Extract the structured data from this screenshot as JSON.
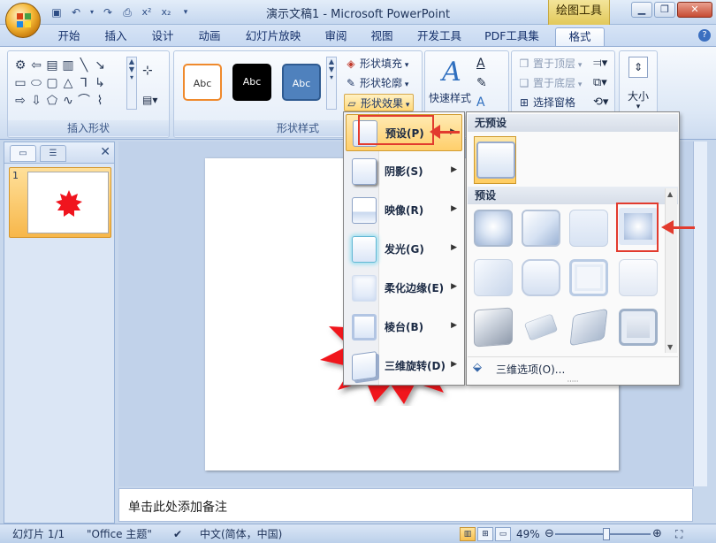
{
  "window": {
    "title": "演示文稿1 - Microsoft PowerPoint",
    "context_tool": "绘图工具"
  },
  "tabs": [
    {
      "label": "开始"
    },
    {
      "label": "插入"
    },
    {
      "label": "设计"
    },
    {
      "label": "动画"
    },
    {
      "label": "幻灯片放映"
    },
    {
      "label": "审阅"
    },
    {
      "label": "视图"
    },
    {
      "label": "开发工具"
    },
    {
      "label": "PDF工具集"
    },
    {
      "label": "格式"
    }
  ],
  "ribbon": {
    "insert_shapes": {
      "label": "插入形状"
    },
    "shape_styles": {
      "label": "形状样式",
      "thumbs": [
        "Abc",
        "Abc",
        "Abc"
      ],
      "fill": "形状填充",
      "outline": "形状轮廓",
      "effects": "形状效果"
    },
    "wordart": {
      "quick_styles": "快速样式"
    },
    "arrange": {
      "bring_front": "置于顶层",
      "send_back": "置于底层",
      "selection_pane": "选择窗格"
    },
    "size": {
      "label": "大小"
    }
  },
  "slide_pane": {
    "slide_number": "1"
  },
  "effects_menu": {
    "items": [
      {
        "label": "预设(P)"
      },
      {
        "label": "阴影(S)"
      },
      {
        "label": "映像(R)"
      },
      {
        "label": "发光(G)"
      },
      {
        "label": "柔化边缘(E)"
      },
      {
        "label": "棱台(B)"
      },
      {
        "label": "三维旋转(D)"
      }
    ]
  },
  "preset_submenu": {
    "no_preset_header": "无预设",
    "preset_header": "预设",
    "footer": "三维选项(O)..."
  },
  "notes": {
    "placeholder": "单击此处添加备注"
  },
  "status": {
    "slide": "幻灯片 1/1",
    "theme": "\"Office 主题\"",
    "language": "中文(简体，中国)",
    "zoom": "49%"
  },
  "colors": {
    "accent": "#e23b2e",
    "star": "#f0141e",
    "ribbon_blue": "#c7d7ec"
  }
}
